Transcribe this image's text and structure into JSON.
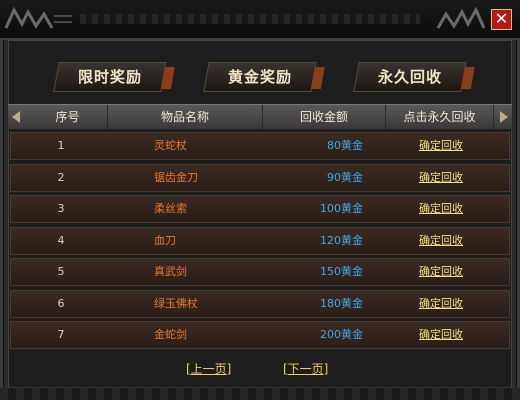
{
  "header": {
    "close_label": "✕"
  },
  "tabs": [
    {
      "label": "限时奖励"
    },
    {
      "label": "黄金奖励"
    },
    {
      "label": "永久回收"
    }
  ],
  "table": {
    "headers": [
      "序号",
      "物品名称",
      "回收金额",
      "点击永久回收"
    ],
    "rows": [
      {
        "index": "1",
        "name": "灵蛇杖",
        "amount": "80",
        "unit": "黄金",
        "action": "确定回收"
      },
      {
        "index": "2",
        "name": "锯齿金刀",
        "amount": "90",
        "unit": "黄金",
        "action": "确定回收"
      },
      {
        "index": "3",
        "name": "柔丝索",
        "amount": "100",
        "unit": "黄金",
        "action": "确定回收"
      },
      {
        "index": "4",
        "name": "血刀",
        "amount": "120",
        "unit": "黄金",
        "action": "确定回收"
      },
      {
        "index": "5",
        "name": "真武剑",
        "amount": "150",
        "unit": "黄金",
        "action": "确定回收"
      },
      {
        "index": "6",
        "name": "绿玉佛杖",
        "amount": "180",
        "unit": "黄金",
        "action": "确定回收"
      },
      {
        "index": "7",
        "name": "金蛇剑",
        "amount": "200",
        "unit": "黄金",
        "action": "确定回收"
      }
    ]
  },
  "pager": {
    "prev": "[上一页]",
    "next": "[下一页]"
  },
  "colors": {
    "accent": "#e8782a",
    "amount": "#3fa8e8",
    "link": "#f0e080",
    "close": "#b21a12"
  }
}
